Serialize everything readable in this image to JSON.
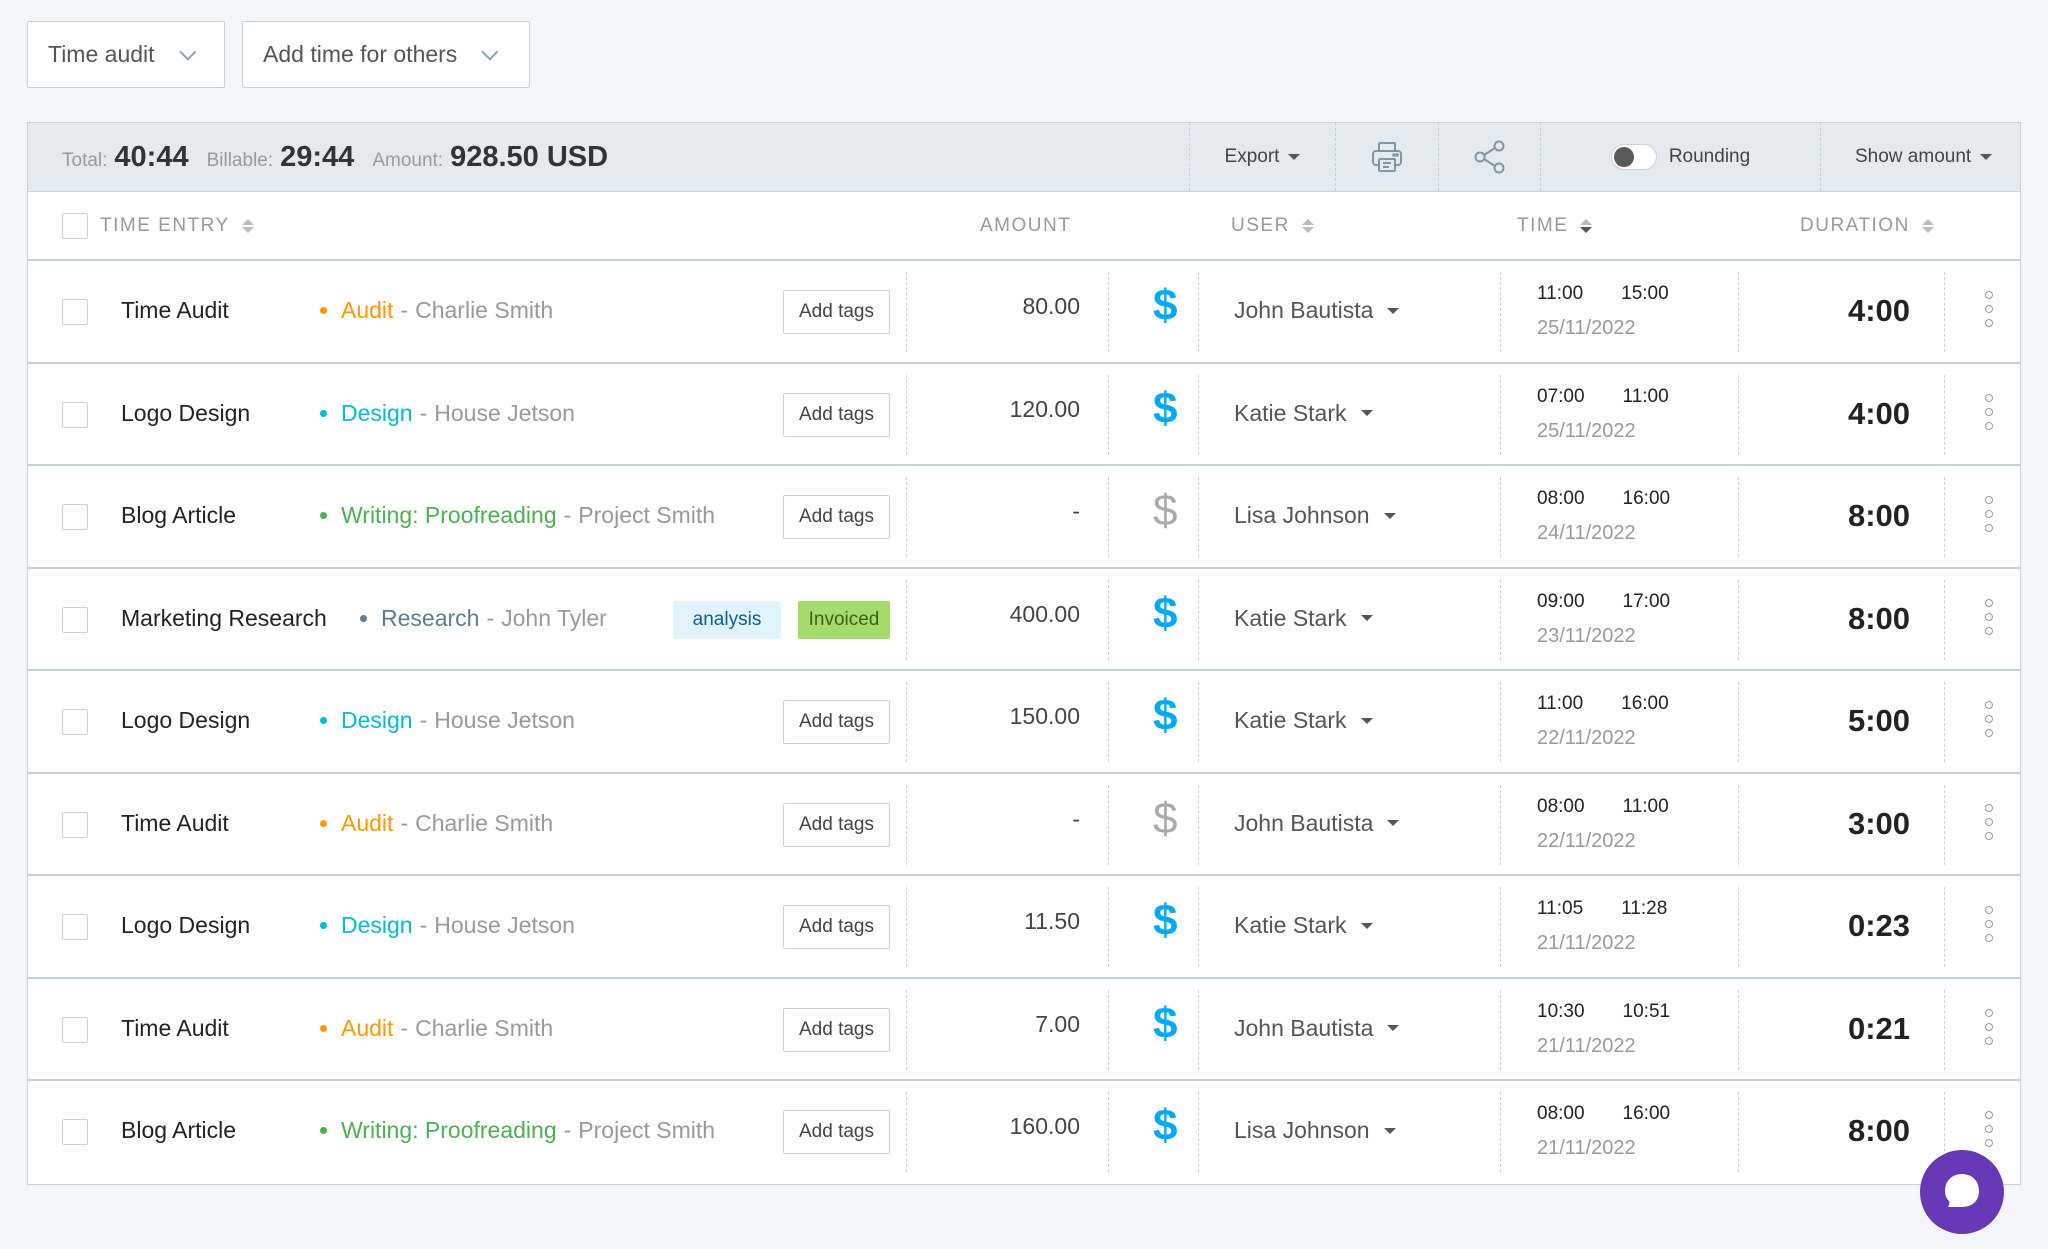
{
  "top_controls": {
    "template_dropdown": "Time audit",
    "add_for_others_dropdown": "Add time for others"
  },
  "summary": {
    "total_label": "Total:",
    "total_value": "40:44",
    "billable_label": "Billable:",
    "billable_value": "29:44",
    "amount_label": "Amount:",
    "amount_value": "928.50 USD",
    "export_label": "Export",
    "rounding_label": "Rounding",
    "rounding_enabled": false,
    "show_amount_label": "Show amount"
  },
  "columns": {
    "time_entry": "TIME ENTRY",
    "amount": "AMOUNT",
    "user": "USER",
    "time": "TIME",
    "duration": "DURATION"
  },
  "colors": {
    "billable_accent": "#03a9f4",
    "chat_button": "#6638b6",
    "project_audit": "#ff9800",
    "project_design": "#00bcd4",
    "project_writing": "#4caf50",
    "project_research": "#607d8b"
  },
  "add_tags_label": "Add tags",
  "entries": [
    {
      "description": "Time Audit",
      "project": "Audit",
      "project_color": "#ff9800",
      "client": "Charlie Smith",
      "tags": [],
      "amount": "80.00",
      "billable": true,
      "user": "John Bautista",
      "start": "11:00",
      "end": "15:00",
      "date": "25/11/2022",
      "duration": "4:00"
    },
    {
      "description": "Logo Design",
      "project": "Design",
      "project_color": "#00bcd4",
      "client": "House Jetson",
      "tags": [],
      "amount": "120.00",
      "billable": true,
      "user": "Katie Stark",
      "start": "07:00",
      "end": "11:00",
      "date": "25/11/2022",
      "duration": "4:00"
    },
    {
      "description": "Blog Article",
      "project": "Writing: Proofreading",
      "project_color": "#4caf50",
      "client": "Project Smith",
      "tags": [],
      "amount": "-",
      "billable": false,
      "user": "Lisa Johnson",
      "start": "08:00",
      "end": "16:00",
      "date": "24/11/2022",
      "duration": "8:00"
    },
    {
      "description": "Marketing Research",
      "project": "Research",
      "project_color": "#607d8b",
      "client": "John Tyler",
      "tags": [
        "analysis",
        "Invoiced"
      ],
      "amount": "400.00",
      "billable": true,
      "user": "Katie Stark",
      "start": "09:00",
      "end": "17:00",
      "date": "23/11/2022",
      "duration": "8:00"
    },
    {
      "description": "Logo Design",
      "project": "Design",
      "project_color": "#00bcd4",
      "client": "House Jetson",
      "tags": [],
      "amount": "150.00",
      "billable": true,
      "user": "Katie Stark",
      "start": "11:00",
      "end": "16:00",
      "date": "22/11/2022",
      "duration": "5:00"
    },
    {
      "description": "Time Audit",
      "project": "Audit",
      "project_color": "#ff9800",
      "client": "Charlie Smith",
      "tags": [],
      "amount": "-",
      "billable": false,
      "user": "John Bautista",
      "start": "08:00",
      "end": "11:00",
      "date": "22/11/2022",
      "duration": "3:00"
    },
    {
      "description": "Logo Design",
      "project": "Design",
      "project_color": "#00bcd4",
      "client": "House Jetson",
      "tags": [],
      "amount": "11.50",
      "billable": true,
      "user": "Katie Stark",
      "start": "11:05",
      "end": "11:28",
      "date": "21/11/2022",
      "duration": "0:23"
    },
    {
      "description": "Time Audit",
      "project": "Audit",
      "project_color": "#ff9800",
      "client": "Charlie Smith",
      "tags": [],
      "amount": "7.00",
      "billable": true,
      "user": "John Bautista",
      "start": "10:30",
      "end": "10:51",
      "date": "21/11/2022",
      "duration": "0:21"
    },
    {
      "description": "Blog Article",
      "project": "Writing: Proofreading",
      "project_color": "#4caf50",
      "client": "Project Smith",
      "tags": [],
      "amount": "160.00",
      "billable": true,
      "user": "Lisa Johnson",
      "start": "08:00",
      "end": "16:00",
      "date": "21/11/2022",
      "duration": "8:00"
    }
  ],
  "icons": {
    "dollar": "$"
  }
}
